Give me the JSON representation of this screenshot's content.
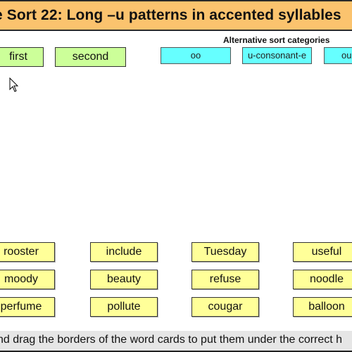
{
  "title": "e Sort 22: Long –u patterns in accented syllables",
  "header_categories": [
    {
      "label": "first"
    },
    {
      "label": "second"
    }
  ],
  "alternative": {
    "label": "Alternative sort categories",
    "categories": [
      {
        "label": "oo"
      },
      {
        "label": "u-consonant-e"
      },
      {
        "label": "ou"
      }
    ]
  },
  "word_cards": [
    {
      "label": "rooster"
    },
    {
      "label": "include"
    },
    {
      "label": "Tuesday"
    },
    {
      "label": "useful"
    },
    {
      "label": "moody"
    },
    {
      "label": "beauty"
    },
    {
      "label": "refuse"
    },
    {
      "label": "noodle"
    },
    {
      "label": "perfume"
    },
    {
      "label": "pollute"
    },
    {
      "label": "cougar"
    },
    {
      "label": "balloon"
    }
  ],
  "instructions": "nd drag the borders of the word cards to put them under the correct h",
  "colors": {
    "title_bg": "#fbc36e",
    "header_card_bg": "#ccff99",
    "alt_card_bg": "#66ffff",
    "word_card_bg": "#ffff99",
    "instructions_bg": "#e6e6e6"
  },
  "cursor": "arrow-pointer"
}
